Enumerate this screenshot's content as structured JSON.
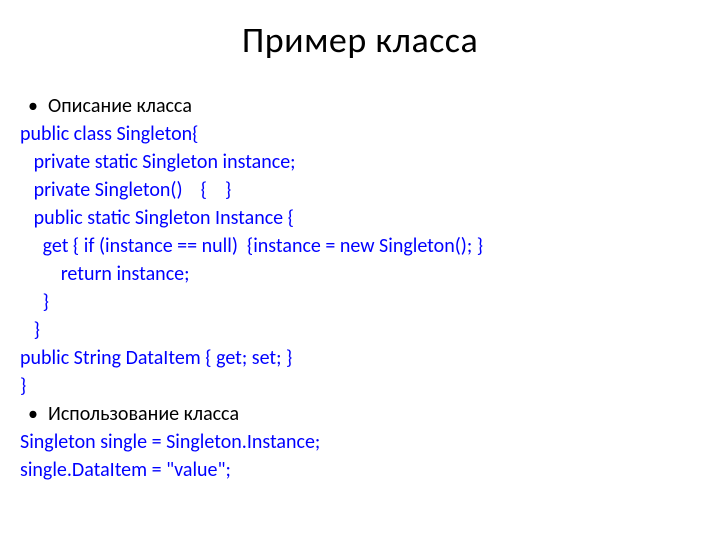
{
  "title": "Пример класса",
  "sections": [
    {
      "bullet": "Описание класса",
      "code": "public class Singleton{\n   private static Singleton instance;\n   private Singleton()    {    }\n   public static Singleton Instance {\n     get { if (instance == null)  {instance = new Singleton(); }\n         return instance;\n     }\n   }\npublic String DataItem { get; set; }\n}"
    },
    {
      "bullet": "Использование класса",
      "code": "Singleton single = Singleton.Instance;\nsingle.DataItem = \"value\";"
    }
  ]
}
